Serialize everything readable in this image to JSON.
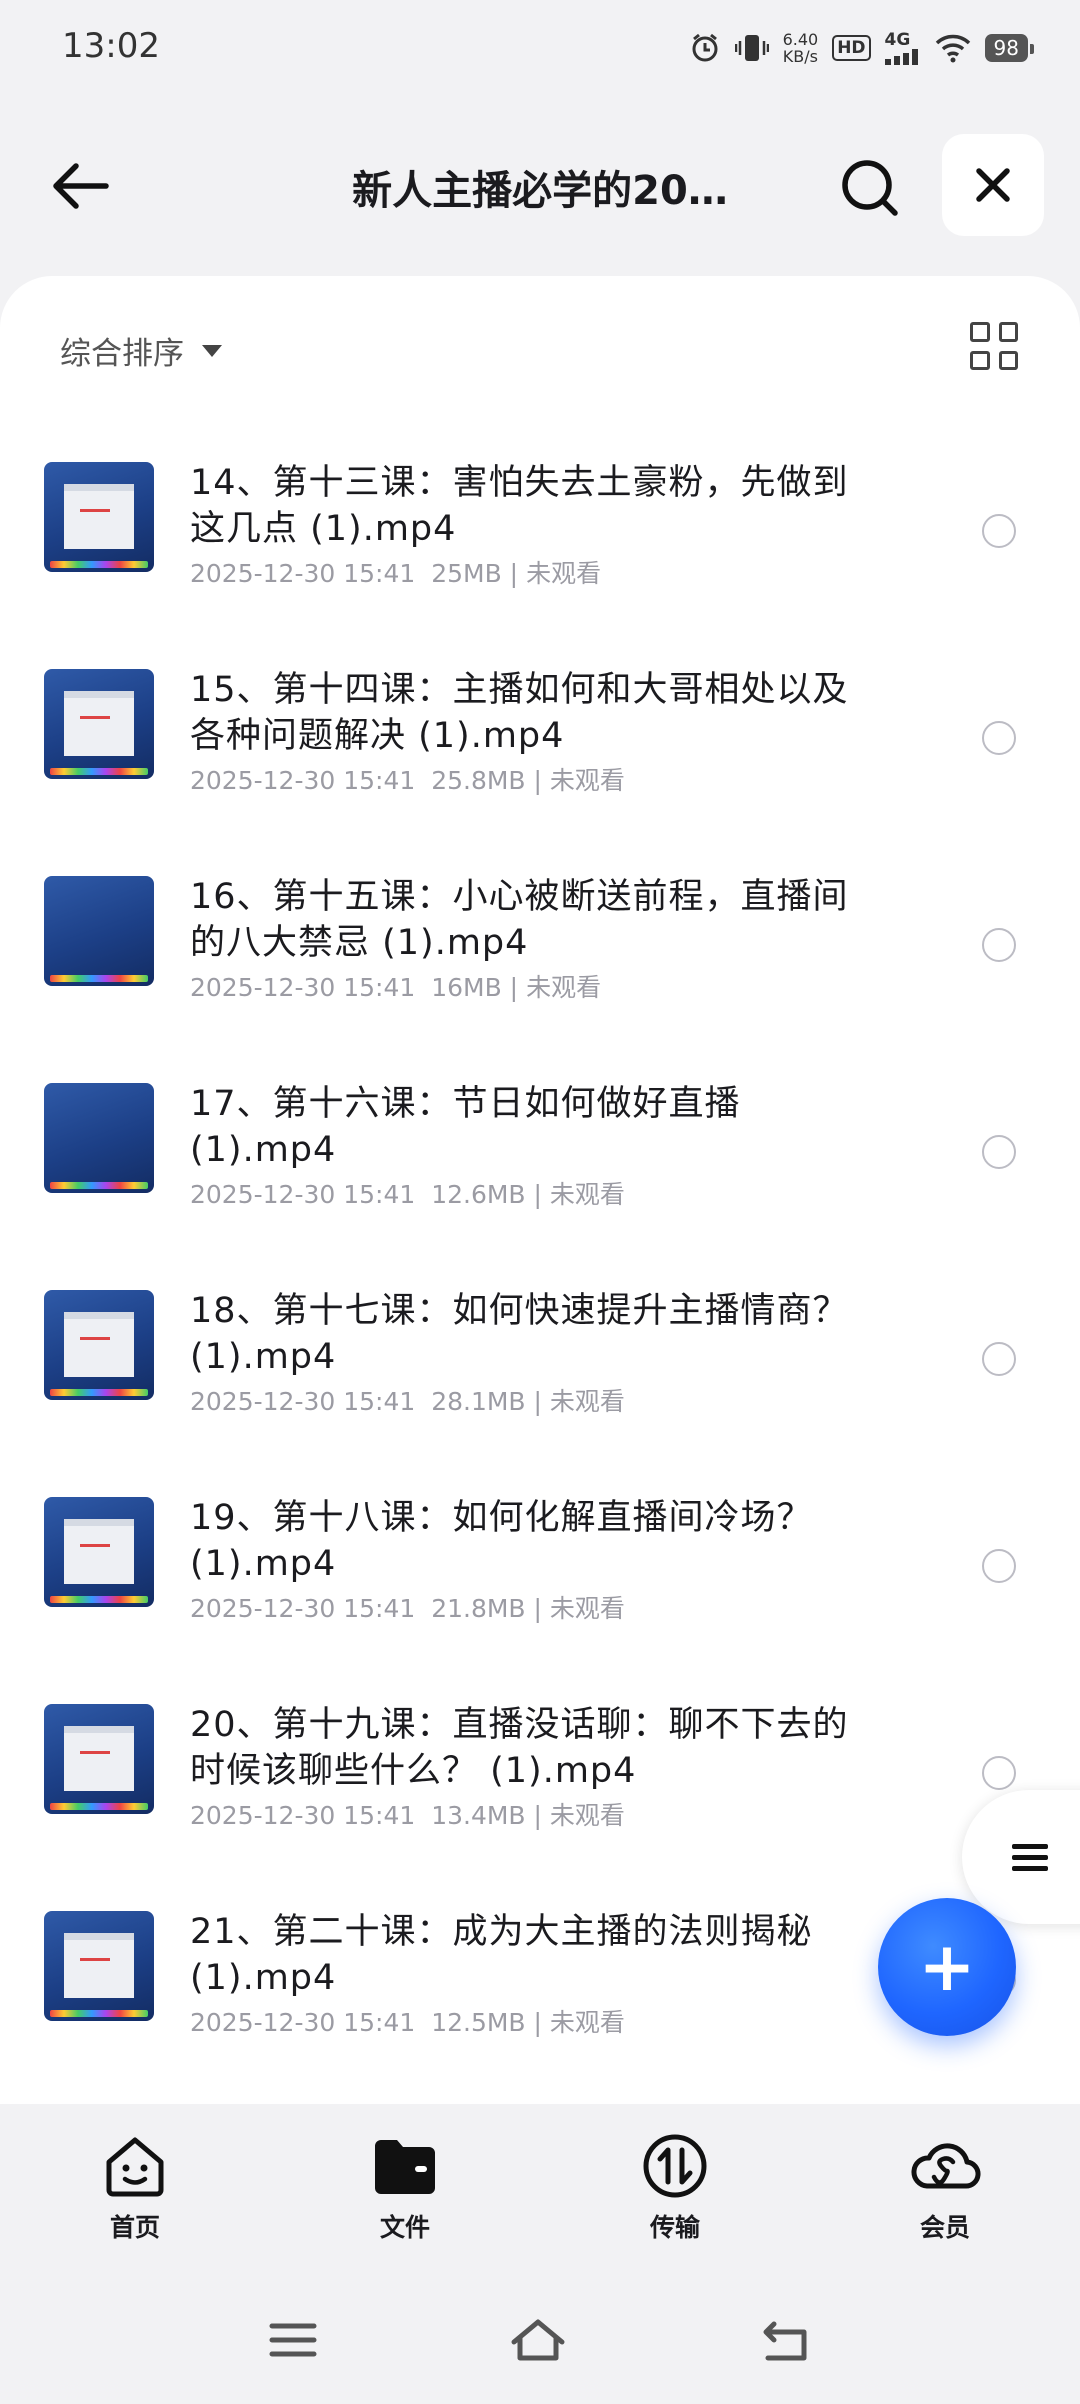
{
  "status_bar": {
    "time": "13:02",
    "net_speed_value": "6.40",
    "net_speed_unit": "KB/s",
    "hd_badge": "HD",
    "network": "4G",
    "battery": "98"
  },
  "header": {
    "title": "新人主播必学的20…",
    "icons": [
      "back-arrow-icon",
      "search-icon",
      "close-icon"
    ]
  },
  "toolbar": {
    "sort_label": "综合排序",
    "view_toggle_icon": "grid-view-icon"
  },
  "files": [
    {
      "name": "14、第十三课：害怕失去土豪粉，先做到这几点 (1).mp4",
      "date": "2025-12-30 15:41",
      "size": "25MB",
      "status": "未观看",
      "thumb": "slide"
    },
    {
      "name": "15、第十四课：主播如何和大哥相处以及各种问题解决 (1).mp4",
      "date": "2025-12-30 15:41",
      "size": "25.8MB",
      "status": "未观看",
      "thumb": "slide"
    },
    {
      "name": "16、第十五课：小心被断送前程，直播间的八大禁忌 (1).mp4",
      "date": "2025-12-30 15:41",
      "size": "16MB",
      "status": "未观看",
      "thumb": "plain"
    },
    {
      "name": "17、第十六课：节日如何做好直播 (1).mp4",
      "date": "2025-12-30 15:41",
      "size": "12.6MB",
      "status": "未观看",
      "thumb": "plain"
    },
    {
      "name": "18、第十七课：如何快速提升主播情商？ (1).mp4",
      "date": "2025-12-30 15:41",
      "size": "28.1MB",
      "status": "未观看",
      "thumb": "slide"
    },
    {
      "name": "19、第十八课：如何化解直播间冷场？ (1).mp4",
      "date": "2025-12-30 15:41",
      "size": "21.8MB",
      "status": "未观看",
      "thumb": "slide"
    },
    {
      "name": "20、第十九课：直播没话聊：聊不下去的时候该聊些什么？ (1).mp4",
      "date": "2025-12-30 15:41",
      "size": "13.4MB",
      "status": "未观看",
      "thumb": "slide"
    },
    {
      "name": "21、第二十课：成为大主播的法则揭秘 (1).mp4",
      "date": "2025-12-30 15:41",
      "size": "12.5MB",
      "status": "未观看",
      "thumb": "slide"
    }
  ],
  "floating": {
    "side_handle_icon": "menu-icon",
    "fab_label": "+"
  },
  "bottom_nav": [
    {
      "label": "首页",
      "icon": "home-smile-icon"
    },
    {
      "label": "文件",
      "icon": "folder-icon"
    },
    {
      "label": "传输",
      "icon": "transfer-icon"
    },
    {
      "label": "会员",
      "icon": "cloud-vip-icon"
    }
  ],
  "system_nav": [
    "menu-icon",
    "home-icon",
    "back-icon"
  ],
  "colors": {
    "accent": "#1f66ff",
    "background": "#f2f2f4",
    "meta_text": "#9b9ba3"
  }
}
